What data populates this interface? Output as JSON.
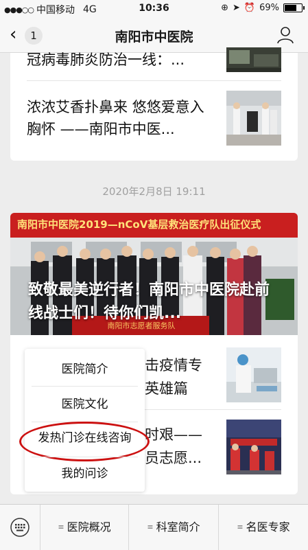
{
  "status_bar": {
    "carrier": "中国移动",
    "network": "4G",
    "time": "10:36",
    "battery": "69%"
  },
  "nav": {
    "back_count": "1",
    "title": "南阳市中医院"
  },
  "articles_top": [
    {
      "title": "冠病毒肺炎防治一线：..."
    },
    {
      "title": "浓浓艾香扑鼻来 悠悠爱意入胸怀 ——南阳市中医..."
    }
  ],
  "timestamp": "2020年2月8日 19:11",
  "feature": {
    "banner_text": "南阳市中医院2019—nCoV基层救治医疗队出征仪式",
    "cover_title": "致敬最美逆行者！南阳市中医院赴前线战士们！待你们凯...",
    "bottom_banner_text": "南阳市志愿者服务队"
  },
  "articles_bottom": [
    {
      "title_fragment_1": "击疫情专",
      "title_fragment_2": "英雄篇"
    },
    {
      "title_fragment_1": "时艰——",
      "title_fragment_2": "员志愿..."
    }
  ],
  "popup_menu": [
    "医院简介",
    "医院文化",
    "发热门诊在线咨询",
    "我的问诊"
  ],
  "bottom_menu": [
    "医院概况",
    "科室简介",
    "名医专家"
  ]
}
